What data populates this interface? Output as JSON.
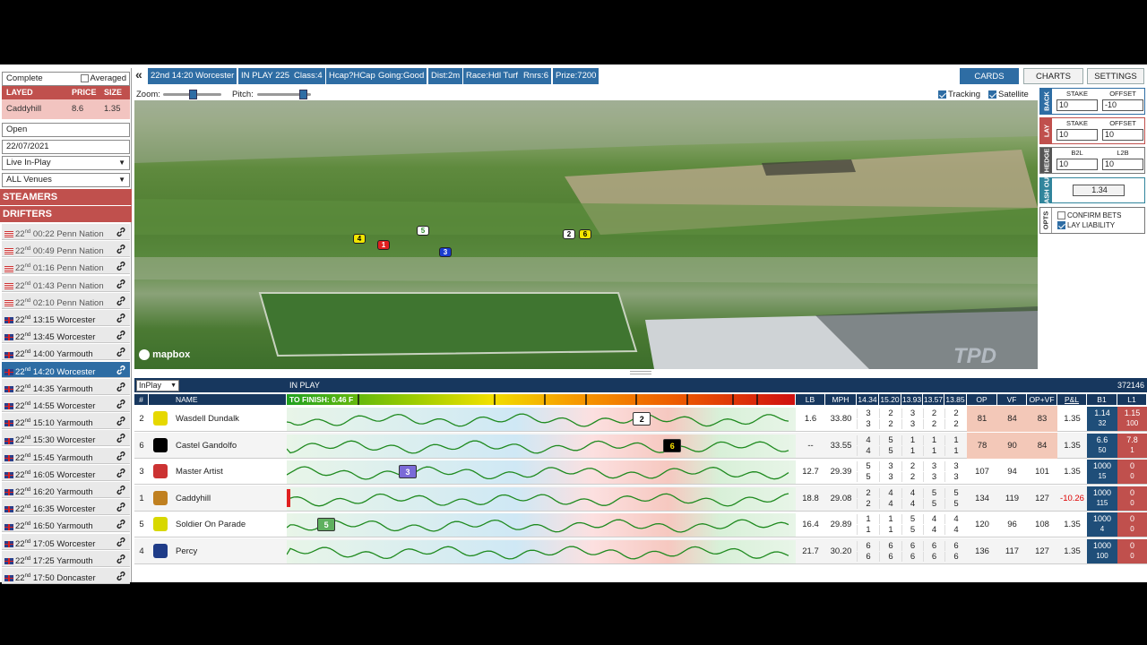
{
  "sidebar": {
    "status_value": "Complete",
    "averaged_label": "Averaged",
    "layed_table": {
      "headers": [
        "LAYED",
        "PRICE",
        "SIZE"
      ],
      "row": [
        "Caddyhill",
        "8.6",
        "1.35"
      ]
    },
    "market_status": "Open",
    "date": "22/07/2021",
    "mode_select": "Live In-Play",
    "venue_select": "ALL Venues",
    "steamers_label": "STEAMERS",
    "drifters_label": "DRIFTERS",
    "races": [
      {
        "day": "22",
        "suffix": "nd",
        "time": "00:22",
        "venue": "Penn Nation",
        "flag": "us"
      },
      {
        "day": "22",
        "suffix": "nd",
        "time": "00:49",
        "venue": "Penn Nation",
        "flag": "us"
      },
      {
        "day": "22",
        "suffix": "nd",
        "time": "01:16",
        "venue": "Penn Nation",
        "flag": "us"
      },
      {
        "day": "22",
        "suffix": "nd",
        "time": "01:43",
        "venue": "Penn Nation",
        "flag": "us"
      },
      {
        "day": "22",
        "suffix": "nd",
        "time": "02:10",
        "venue": "Penn Nation",
        "flag": "us"
      },
      {
        "day": "22",
        "suffix": "nd",
        "time": "13:15",
        "venue": "Worcester",
        "flag": "uk"
      },
      {
        "day": "22",
        "suffix": "nd",
        "time": "13:45",
        "venue": "Worcester",
        "flag": "uk"
      },
      {
        "day": "22",
        "suffix": "nd",
        "time": "14:00",
        "venue": "Yarmouth",
        "flag": "uk"
      },
      {
        "day": "22",
        "suffix": "nd",
        "time": "14:20",
        "venue": "Worcester",
        "flag": "uk",
        "active": true
      },
      {
        "day": "22",
        "suffix": "nd",
        "time": "14:35",
        "venue": "Yarmouth",
        "flag": "uk"
      },
      {
        "day": "22",
        "suffix": "nd",
        "time": "14:55",
        "venue": "Worcester",
        "flag": "uk"
      },
      {
        "day": "22",
        "suffix": "nd",
        "time": "15:10",
        "venue": "Yarmouth",
        "flag": "uk"
      },
      {
        "day": "22",
        "suffix": "nd",
        "time": "15:30",
        "venue": "Worcester",
        "flag": "uk"
      },
      {
        "day": "22",
        "suffix": "nd",
        "time": "15:45",
        "venue": "Yarmouth",
        "flag": "uk"
      },
      {
        "day": "22",
        "suffix": "nd",
        "time": "16:05",
        "venue": "Worcester",
        "flag": "uk"
      },
      {
        "day": "22",
        "suffix": "nd",
        "time": "16:20",
        "venue": "Yarmouth",
        "flag": "uk"
      },
      {
        "day": "22",
        "suffix": "nd",
        "time": "16:35",
        "venue": "Worcester",
        "flag": "uk"
      },
      {
        "day": "22",
        "suffix": "nd",
        "time": "16:50",
        "venue": "Yarmouth",
        "flag": "uk"
      },
      {
        "day": "22",
        "suffix": "nd",
        "time": "17:05",
        "venue": "Worcester",
        "flag": "uk"
      },
      {
        "day": "22",
        "suffix": "nd",
        "time": "17:25",
        "venue": "Yarmouth",
        "flag": "uk"
      },
      {
        "day": "22",
        "suffix": "nd",
        "time": "17:50",
        "venue": "Doncaster",
        "flag": "uk"
      }
    ]
  },
  "topbar": {
    "collapse_glyph": "«",
    "chips": [
      "22nd 14:20 Worcester",
      "IN PLAY  225",
      "Class:4",
      "Hcap?HCap",
      "Going:Good",
      "Dist:2m",
      "Race:Hdl Turf",
      "Rnrs:6",
      "Prize:7200"
    ],
    "buttons": [
      "CARDS",
      "CHARTS",
      "SETTINGS"
    ]
  },
  "map": {
    "zoom_label": "Zoom:",
    "pitch_label": "Pitch:",
    "tracking_label": "Tracking",
    "satellite_label": "Satellite",
    "attribution": "mapbox",
    "watermark": "TPD",
    "zoom_level": 0.5,
    "pitch_level": 0.85,
    "runners": [
      {
        "num": "4",
        "bg": "#f2e600",
        "fg": "#000"
      },
      {
        "num": "1",
        "bg": "#e02020",
        "fg": "#fff"
      },
      {
        "num": "5",
        "bg": "#ffffff",
        "fg": "#2a8a2a"
      },
      {
        "num": "3",
        "bg": "#1a3ccf",
        "fg": "#fff"
      },
      {
        "num": "2",
        "bg": "#ffffff",
        "fg": "#000"
      },
      {
        "num": "6",
        "bg": "#f2e600",
        "fg": "#000"
      }
    ]
  },
  "rpanel": {
    "back": {
      "label": "BACK",
      "stake_label": "STAKE",
      "offset_label": "OFFSET",
      "stake": "10",
      "offset": "-10"
    },
    "lay": {
      "label": "LAY",
      "stake_label": "STAKE",
      "offset_label": "OFFSET",
      "stake": "10",
      "offset": "10"
    },
    "hedge": {
      "label": "HEDGE",
      "b2l_label": "B2L",
      "l2b_label": "L2B",
      "b2l": "10",
      "l2b": "10"
    },
    "cashout": {
      "label": "CASH OUT",
      "value": "1.34"
    },
    "opts": {
      "label": "OPTS",
      "confirm_bets": "CONFIRM BETS",
      "lay_liability": "LAY LIABILITY",
      "confirm_checked": false,
      "liability_checked": true
    }
  },
  "grid": {
    "filter_select": "InPlay",
    "inplay_label": "IN PLAY",
    "market_id": "372146",
    "to_finish_label": "TO FINISH: 0.46 F",
    "headers": {
      "num": "#",
      "name": "NAME",
      "lb": "LB",
      "mph": "MPH",
      "s1": "14.34",
      "s2": "15.20",
      "s3": "13.93",
      "s4": "13.57",
      "s5": "13.85",
      "op": "OP",
      "vf": "VF",
      "opvf": "OP+VF",
      "pl": "P&L",
      "b1": "B1",
      "l1": "L1"
    },
    "runners": [
      {
        "num": "2",
        "name": "Wasdell Dundalk",
        "lb": "1.6",
        "mph": "33.80",
        "sects": [
          [
            "3",
            "3"
          ],
          [
            "2",
            "2"
          ],
          [
            "3",
            "3"
          ],
          [
            "2",
            "2"
          ],
          [
            "2",
            "2"
          ]
        ],
        "op": "81",
        "vf": "84",
        "opvf": "83",
        "pl": "1.35",
        "b1": [
          "1.14",
          "32"
        ],
        "l1": [
          "1.15",
          "100"
        ],
        "silk": "#e6d800",
        "badge": "2",
        "badge_bg": "#fff",
        "badge_fg": "#000",
        "badge_pos": 0.68
      },
      {
        "num": "6",
        "name": "Castel Gandolfo",
        "lb": "--",
        "mph": "33.55",
        "sects": [
          [
            "4",
            "4"
          ],
          [
            "5",
            "5"
          ],
          [
            "1",
            "1"
          ],
          [
            "1",
            "1"
          ],
          [
            "1",
            "1"
          ]
        ],
        "op": "78",
        "vf": "90",
        "opvf": "84",
        "pl": "1.35",
        "b1": [
          "6.6",
          "50"
        ],
        "l1": [
          "7.8",
          "1"
        ],
        "silk": "#000000",
        "badge": "6",
        "badge_bg": "#000",
        "badge_fg": "#ffe600",
        "badge_pos": 0.74
      },
      {
        "num": "3",
        "name": "Master Artist",
        "lb": "12.7",
        "mph": "29.39",
        "sects": [
          [
            "5",
            "5"
          ],
          [
            "3",
            "3"
          ],
          [
            "2",
            "2"
          ],
          [
            "3",
            "3"
          ],
          [
            "3",
            "3"
          ]
        ],
        "op": "107",
        "vf": "94",
        "opvf": "101",
        "pl": "1.35",
        "b1": [
          "1000",
          "15"
        ],
        "l1": [
          "0",
          "0"
        ],
        "silk": "#c33",
        "badge": "3",
        "badge_bg": "#7a6ad8",
        "badge_fg": "#fff",
        "badge_pos": 0.22
      },
      {
        "num": "1",
        "name": "Caddyhill",
        "lb": "18.8",
        "mph": "29.08",
        "sects": [
          [
            "2",
            "2"
          ],
          [
            "4",
            "4"
          ],
          [
            "4",
            "4"
          ],
          [
            "5",
            "5"
          ],
          [
            "5",
            "5"
          ]
        ],
        "op": "134",
        "vf": "119",
        "opvf": "127",
        "pl": "-10.26",
        "b1": [
          "1000",
          "115"
        ],
        "l1": [
          "0",
          "0"
        ],
        "silk": "#c08020",
        "badge": "",
        "badge_bg": "#e02020",
        "badge_fg": "#fff",
        "badge_pos": 0.0
      },
      {
        "num": "5",
        "name": "Soldier On Parade",
        "lb": "16.4",
        "mph": "29.89",
        "sects": [
          [
            "1",
            "1"
          ],
          [
            "1",
            "1"
          ],
          [
            "5",
            "5"
          ],
          [
            "4",
            "4"
          ],
          [
            "4",
            "4"
          ]
        ],
        "op": "120",
        "vf": "96",
        "opvf": "108",
        "pl": "1.35",
        "b1": [
          "1000",
          "4"
        ],
        "l1": [
          "0",
          "0"
        ],
        "silk": "#d8d800",
        "badge": "5",
        "badge_bg": "#5fb05f",
        "badge_fg": "#fff",
        "badge_pos": 0.06
      },
      {
        "num": "4",
        "name": "Percy",
        "lb": "21.7",
        "mph": "30.20",
        "sects": [
          [
            "6",
            "6"
          ],
          [
            "6",
            "6"
          ],
          [
            "6",
            "6"
          ],
          [
            "6",
            "6"
          ],
          [
            "6",
            "6"
          ]
        ],
        "op": "136",
        "vf": "117",
        "opvf": "127",
        "pl": "1.35",
        "b1": [
          "1000",
          "100"
        ],
        "l1": [
          "0",
          "0"
        ],
        "silk": "#1f3c88",
        "badge": "",
        "badge_bg": "#fff",
        "badge_fg": "#000",
        "badge_pos": 0.0
      }
    ]
  }
}
